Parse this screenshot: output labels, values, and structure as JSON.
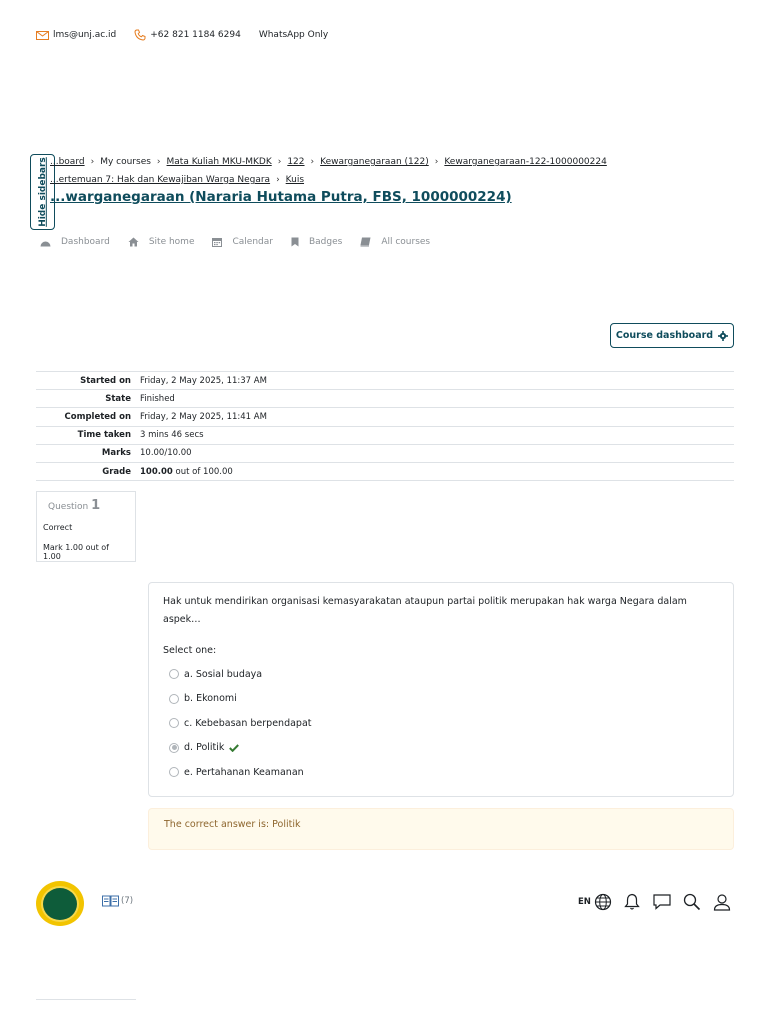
{
  "topbar": {
    "email": "lms@unj.ac.id",
    "phone": "+62 821 1184 6294",
    "note": "WhatsApp Only",
    "email_icon": "envelope-icon",
    "phone_icon": "phone-icon"
  },
  "breadcrumb": {
    "row1": [
      "...board",
      "My courses",
      "Mata Kuliah MKU-MKDK",
      "122",
      "Kewarganegaraan (122)",
      "Kewarganegaraan-122-1000000224"
    ],
    "row2": [
      "...ertemuan 7: Hak dan Kewajiban Warga Negara",
      "Kuis"
    ]
  },
  "course_title": "...warganegaraan (Nararia Hutama Putra, FBS, 1000000224)",
  "hide_sidebars": "Hide sidebars",
  "nav": {
    "dashboard": "Dashboard",
    "site_home": "Site home",
    "calendar": "Calendar",
    "badges": "Badges",
    "all_courses": "All courses"
  },
  "course_dashboard_btn": "Course dashboard",
  "summary": {
    "started_label": "Started on",
    "started": "Friday, 2 May 2025, 11:37 AM",
    "state_label": "State",
    "state": "Finished",
    "completed_label": "Completed on",
    "completed": "Friday, 2 May 2025, 11:41 AM",
    "time_label": "Time taken",
    "time": "3 mins 46 secs",
    "marks_label": "Marks",
    "marks": "10.00/10.00",
    "grade_label": "Grade",
    "grade_value": "100.00",
    "grade_suffix": "out of 100.00"
  },
  "question_info": {
    "label": "Question",
    "number": "1",
    "status": "Correct",
    "mark": "Mark 1.00 out of 1.00"
  },
  "question": {
    "text": "Hak untuk mendirikan organisasi kemasyarakatan ataupun partai politik merupakan hak warga Negara dalam aspek…",
    "prompt": "Select one:",
    "options": {
      "a": "a. Sosial budaya",
      "b": "b. Ekonomi",
      "c": "c. Kebebasan berpendapat",
      "d": "d. Politik",
      "e": "e. Pertahanan Keamanan"
    }
  },
  "correct_answer": "The correct answer is: Politik",
  "footer": {
    "badge_count": "(7)",
    "lang": "EN"
  }
}
